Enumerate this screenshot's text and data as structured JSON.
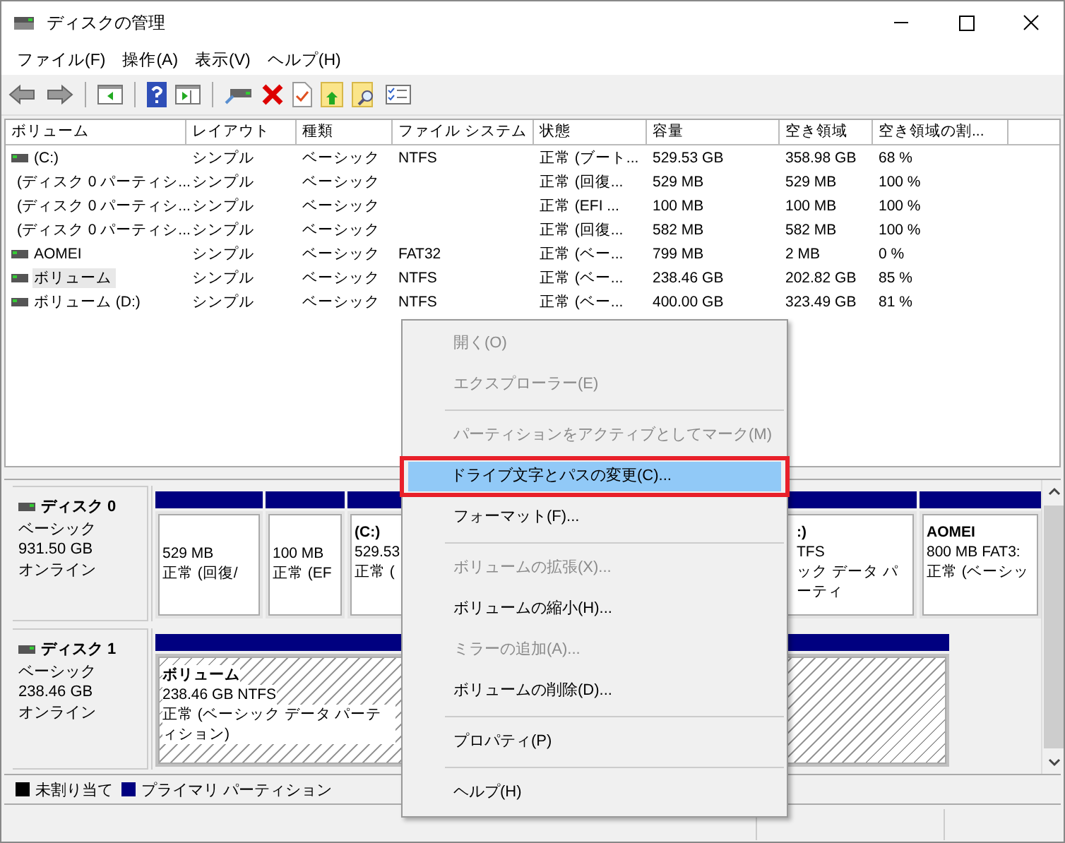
{
  "window": {
    "title": "ディスクの管理"
  },
  "menu": [
    "ファイル(F)",
    "操作(A)",
    "表示(V)",
    "ヘルプ(H)"
  ],
  "toolbar": [
    {
      "kind": "back"
    },
    {
      "kind": "forward"
    },
    {
      "kind": "sep"
    },
    {
      "kind": "panel"
    },
    {
      "kind": "sep"
    },
    {
      "kind": "help"
    },
    {
      "kind": "panel2"
    },
    {
      "kind": "sep"
    },
    {
      "kind": "drive"
    },
    {
      "kind": "delete"
    },
    {
      "kind": "doc"
    },
    {
      "kind": "folderup"
    },
    {
      "kind": "foldersearch"
    },
    {
      "kind": "checklist"
    }
  ],
  "table": {
    "columns": [
      "ボリューム",
      "レイアウト",
      "種類",
      "ファイル システム",
      "状態",
      "容量",
      "空き領域",
      "空き領域の割..."
    ],
    "rows": [
      {
        "selected": false,
        "cells": [
          " (C:)",
          "シンプル",
          "ベーシック",
          "NTFS",
          "正常 (ブート...",
          "529.53 GB",
          "358.98 GB",
          "68 %"
        ]
      },
      {
        "selected": false,
        "cells": [
          "(ディスク 0 パーティシ...",
          "シンプル",
          "ベーシック",
          "",
          "正常 (回復...",
          "529 MB",
          "529 MB",
          "100 %"
        ]
      },
      {
        "selected": false,
        "cells": [
          "(ディスク 0 パーティシ...",
          "シンプル",
          "ベーシック",
          "",
          "正常 (EFI ...",
          "100 MB",
          "100 MB",
          "100 %"
        ]
      },
      {
        "selected": false,
        "cells": [
          "(ディスク 0 パーティシ...",
          "シンプル",
          "ベーシック",
          "",
          "正常 (回復...",
          "582 MB",
          "582 MB",
          "100 %"
        ]
      },
      {
        "selected": false,
        "cells": [
          "AOMEI",
          "シンプル",
          "ベーシック",
          "FAT32",
          "正常 (ベー...",
          "799 MB",
          "2 MB",
          "0 %"
        ]
      },
      {
        "selected": true,
        "cells": [
          "ボリューム",
          "シンプル",
          "ベーシック",
          "NTFS",
          "正常 (ベー...",
          "238.46 GB",
          "202.82 GB",
          "85 %"
        ]
      },
      {
        "selected": false,
        "cells": [
          "ボリューム (D:)",
          "シンプル",
          "ベーシック",
          "NTFS",
          "正常 (ベー...",
          "400.00 GB",
          "323.49 GB",
          "81 %"
        ]
      }
    ]
  },
  "disks": [
    {
      "name": "ディスク 0",
      "type": "ベーシック",
      "size": "931.50 GB",
      "status": "オンライン",
      "partitions": [
        {
          "kind": "normal",
          "lines": [
            "529 MB",
            "正常 (回復/"
          ]
        },
        {
          "kind": "normal",
          "lines": [
            "100 MB",
            "正常 (EF"
          ]
        },
        {
          "kind": "normal",
          "lines": [
            "(C:)",
            "529.53",
            "正常 ("
          ]
        },
        {
          "kind": "covered",
          "lines": [
            ":)",
            "TFS",
            "ック データ パーティ"
          ]
        },
        {
          "kind": "normal",
          "lines": [
            "AOMEI",
            "800 MB FAT3:",
            "正常 (ベーシッ"
          ]
        }
      ]
    },
    {
      "name": "ディスク 1",
      "type": "ベーシック",
      "size": "238.46 GB",
      "status": "オンライン",
      "partitions": [
        {
          "kind": "selected",
          "lines": [
            "ボリューム",
            "238.46 GB NTFS",
            "正常 (ベーシック データ パーティション)"
          ]
        }
      ]
    }
  ],
  "legend": [
    {
      "label": "未割り当て",
      "color": "#000000"
    },
    {
      "label": "プライマリ パーティション",
      "color": "#000080"
    }
  ],
  "context_menu": [
    {
      "kind": "item",
      "label": "開く(O)",
      "disabled": true,
      "selected": false
    },
    {
      "kind": "item",
      "label": "エクスプローラー(E)",
      "disabled": true,
      "selected": false
    },
    {
      "kind": "separator"
    },
    {
      "kind": "item",
      "label": "パーティションをアクティブとしてマーク(M)",
      "disabled": true,
      "selected": false
    },
    {
      "kind": "item",
      "label": "ドライブ文字とパスの変更(C)...",
      "disabled": false,
      "selected": true
    },
    {
      "kind": "item",
      "label": "フォーマット(F)...",
      "disabled": false,
      "selected": false
    },
    {
      "kind": "separator"
    },
    {
      "kind": "item",
      "label": "ボリュームの拡張(X)...",
      "disabled": true,
      "selected": false
    },
    {
      "kind": "item",
      "label": "ボリュームの縮小(H)...",
      "disabled": false,
      "selected": false
    },
    {
      "kind": "item",
      "label": "ミラーの追加(A)...",
      "disabled": true,
      "selected": false
    },
    {
      "kind": "item",
      "label": "ボリュームの削除(D)...",
      "disabled": false,
      "selected": false
    },
    {
      "kind": "separator"
    },
    {
      "kind": "item",
      "label": "プロパティ(P)",
      "disabled": false,
      "selected": false
    },
    {
      "kind": "separator"
    },
    {
      "kind": "item",
      "label": "ヘルプ(H)",
      "disabled": false,
      "selected": false
    }
  ]
}
